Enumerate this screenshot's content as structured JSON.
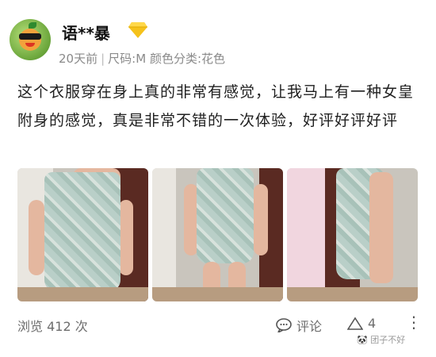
{
  "user": {
    "name": "语**暴",
    "time": "20天前",
    "size": "尺码:M",
    "color": "颜色分类:花色",
    "separator": "|"
  },
  "review_text": "这个衣服穿在身上真的非常有感觉，让我马上有一种女皇附身的感觉，真是非常不错的一次体验，好评好评好评",
  "footer": {
    "views": "浏览 412 次",
    "comment_label": "评论",
    "like_count": "4",
    "more": "⋮"
  },
  "watermark": "🐼 团子不好",
  "icons": {
    "avatar": "fruit-sunglasses-avatar",
    "badge": "diamond-icon",
    "comment": "comment-icon",
    "like": "triangle-like-icon",
    "more": "more-vertical-icon"
  },
  "colors": {
    "diamond": "#f5c21b",
    "meta": "#8a8a8a",
    "footer": "#6d6d6d"
  }
}
